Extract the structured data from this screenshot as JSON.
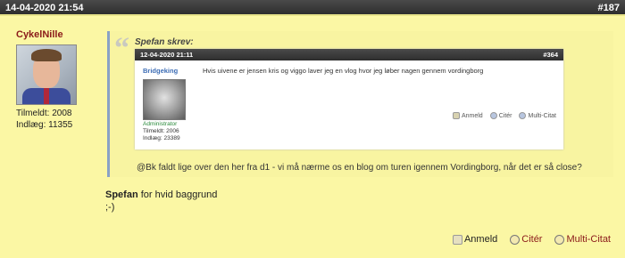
{
  "post": {
    "timestamp": "14-04-2020 21:54",
    "number": "#187"
  },
  "author": {
    "name": "CykelNille",
    "joined": "Tilmeldt: 2008",
    "posts": "Indlæg: 11355"
  },
  "quote": {
    "header": "Spefan skrev:",
    "inner": {
      "timestamp": "12-04-2020 21:11",
      "number": "#364",
      "author": "Bridgeking",
      "role": "Administrator",
      "joined": "Tilmeldt: 2006",
      "posts": "Indlæg: 23389",
      "text": "Hvis uivene er jensen kris og viggo laver jeg en vlog hvor jeg løber nagen gennem vordingborg",
      "actions": {
        "report": "Anmeld",
        "quote": "Citér",
        "multi": "Multi-Citat"
      }
    },
    "reply": "@Bk faldt lige over den her fra d1 - vi må nærme os en blog om turen igennem Vordingborg, når det er så close?"
  },
  "reply": {
    "author": "Spefan",
    "text": "for hvid baggrund",
    "line2": ";-)"
  },
  "actions": {
    "report": "Anmeld",
    "quote": "Citér",
    "multi": "Multi-Citat"
  }
}
